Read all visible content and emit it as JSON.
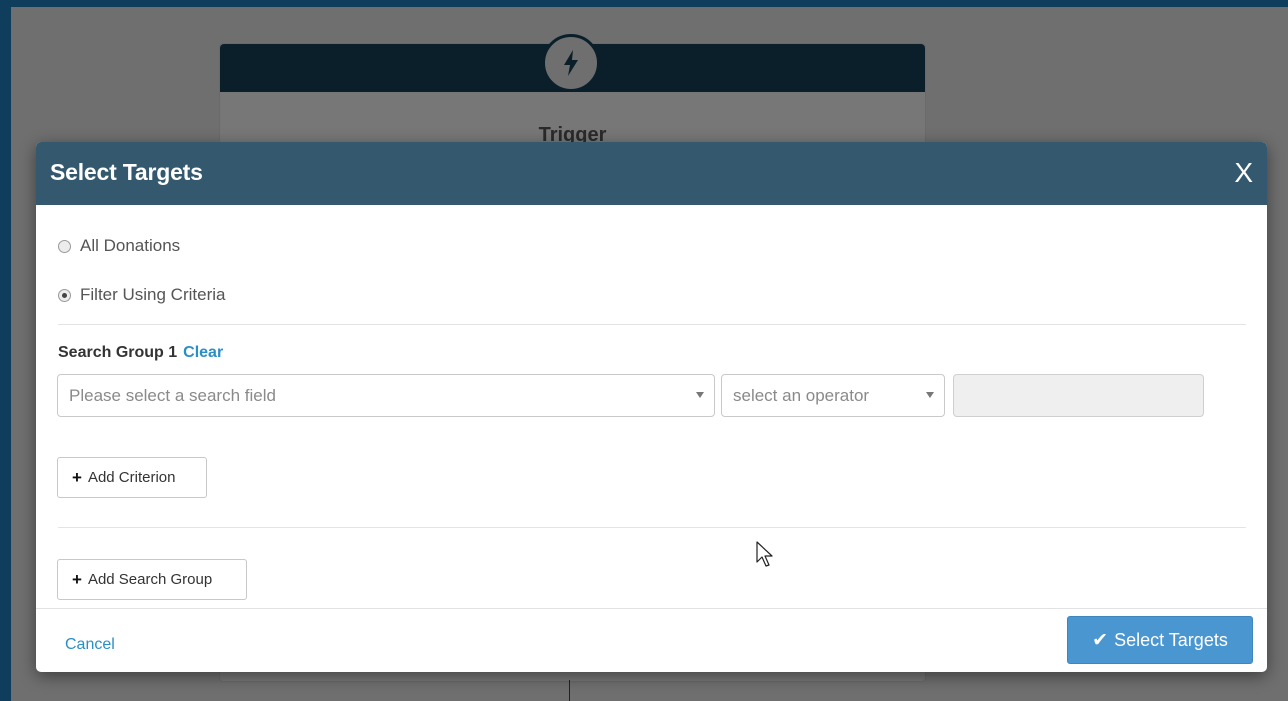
{
  "background": {
    "trigger_card_title": "Trigger",
    "trigger_icon": "lightning-bolt-icon"
  },
  "modal": {
    "title": "Select Targets",
    "close_label": "X",
    "radio_options": [
      {
        "label": "All Donations",
        "checked": false
      },
      {
        "label": "Filter Using Criteria",
        "checked": true
      }
    ],
    "search_group": {
      "title": "Search Group 1",
      "clear_label": "Clear",
      "field_placeholder": "Please select a search field",
      "operator_placeholder": "select an operator",
      "value": ""
    },
    "add_criterion_label": "Add Criterion",
    "add_search_group_label": "Add Search Group",
    "cancel_label": "Cancel",
    "submit_label": "Select Targets"
  },
  "colors": {
    "modal_header": "#34596e",
    "primary_button": "#4a96d1",
    "link": "#2a8fc7",
    "page_frame": "#0f3e5c"
  }
}
